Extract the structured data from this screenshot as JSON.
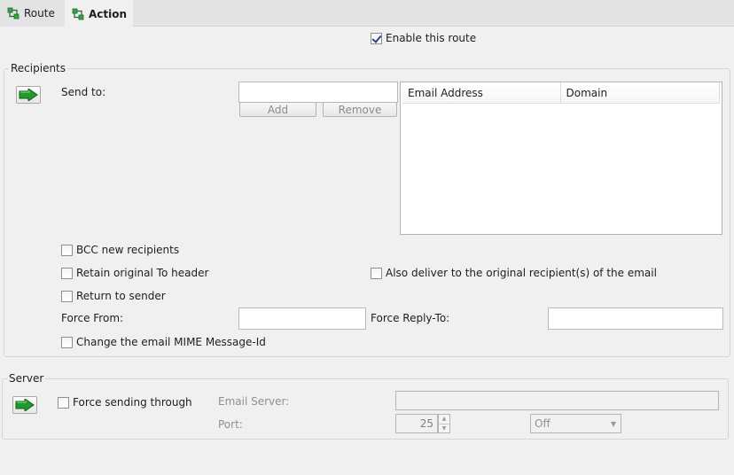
{
  "tabs": [
    {
      "label": "Route",
      "icon": "route-icon",
      "selected": false
    },
    {
      "label": "Action",
      "icon": "route-icon",
      "selected": true
    }
  ],
  "enable_route": {
    "label": "Enable this route",
    "checked": true
  },
  "recipients": {
    "legend": "Recipients",
    "send_to_label": "Send to:",
    "send_to_value": "",
    "add_label": "Add",
    "remove_label": "Remove",
    "table_headers": [
      "Email Address",
      "Domain"
    ],
    "rows": [],
    "bcc": {
      "label": "BCC new recipients",
      "checked": false
    },
    "retain_to": {
      "label": "Retain original To header",
      "checked": false
    },
    "also_deliver": {
      "label": "Also deliver to the original recipient(s) of the email",
      "checked": false
    },
    "return_sender": {
      "label": "Return to sender",
      "checked": false
    },
    "force_from_label": "Force From:",
    "force_from_value": "",
    "force_reply_label": "Force Reply-To:",
    "force_reply_value": "",
    "change_mime": {
      "label": "Change the email MIME Message-Id",
      "checked": false
    }
  },
  "server": {
    "legend": "Server",
    "force_sending": {
      "label": "Force sending through",
      "checked": false
    },
    "email_server_label": "Email Server:",
    "email_server_value": "",
    "port_label": "Port:",
    "port_value": "25",
    "tls_value": "Off"
  },
  "colors": {
    "arrow_green": "#1f9a2b",
    "check_blue": "#2b3f8e"
  }
}
